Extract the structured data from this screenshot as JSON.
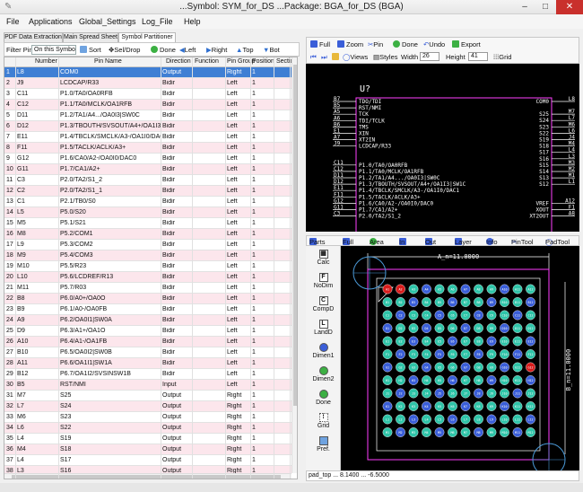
{
  "window": {
    "title": "...Symbol: SYM_for_DS ...Package: BGA_for_DS  (BGA)",
    "minimize": "–",
    "maximize": "□",
    "close": "✕"
  },
  "menu": [
    "File",
    "Applications",
    "Global_Settings",
    "Log_File",
    "Help"
  ],
  "left_tabs": [
    "PDF Data Extraction",
    "Main Spread Sheet",
    "Symbol Partitioner"
  ],
  "toolbar": {
    "filter_label": "Filter Pins",
    "filter_value": "On this Symbo",
    "sort": "Sort",
    "sel_drop": "Sel/Drop",
    "done": "Done",
    "left": "Left",
    "right": "Right",
    "top": "Top",
    "bot": "Bot"
  },
  "columns": [
    "Number",
    "Pin Name",
    "Direction",
    "Function",
    "Pin Group",
    "Position",
    "Section"
  ],
  "rows": [
    [
      "1",
      "L8",
      "COM0",
      "Output",
      "",
      "Right",
      "1"
    ],
    [
      "2",
      "J9",
      "LCDCAP/R33",
      "Bidir",
      "",
      "Left",
      "1"
    ],
    [
      "3",
      "C11",
      "P1.0/TA0/OA0RFB",
      "Bidir",
      "",
      "Left",
      "1"
    ],
    [
      "4",
      "C12",
      "P1.1/TA0/MCLK/OA1RFB",
      "Bidir",
      "",
      "Left",
      "1"
    ],
    [
      "5",
      "D11",
      "P1.2/TA1/A4.../OA0I3|SW0C",
      "Bidir",
      "",
      "Left",
      "1"
    ],
    [
      "6",
      "D12",
      "P1.3/TBOUTH/SVSOUT/A4+/OA1I3...",
      "Bidir",
      "",
      "Left",
      "1"
    ],
    [
      "7",
      "E11",
      "P1.4/TBCLK/SMCLK/A3-/OA1I0/DAC1",
      "Bidir",
      "",
      "Left",
      "1"
    ],
    [
      "8",
      "F11",
      "P1.5/TACLK/ACLK/A3+",
      "Bidir",
      "",
      "Left",
      "1"
    ],
    [
      "9",
      "G12",
      "P1.6/CA0/A2-/OA0I0/DAC0",
      "Bidir",
      "",
      "Left",
      "1"
    ],
    [
      "10",
      "G11",
      "P1.7/CA1/A2+",
      "Bidir",
      "",
      "Left",
      "1"
    ],
    [
      "11",
      "C3",
      "P2.0/TA2/S1_2",
      "Bidir",
      "",
      "Left",
      "1"
    ],
    [
      "12",
      "C2",
      "P2.0/TA2/S1_1",
      "Bidir",
      "",
      "Left",
      "1"
    ],
    [
      "13",
      "C1",
      "P2.1/TB0/S0",
      "Bidir",
      "",
      "Left",
      "1"
    ],
    [
      "14",
      "L5",
      "P5.0/S20",
      "Bidir",
      "",
      "Left",
      "1"
    ],
    [
      "15",
      "M5",
      "P5.1/S21",
      "Bidir",
      "",
      "Left",
      "1"
    ],
    [
      "16",
      "M8",
      "P5.2/COM1",
      "Bidir",
      "",
      "Left",
      "1"
    ],
    [
      "17",
      "L9",
      "P5.3/COM2",
      "Bidir",
      "",
      "Left",
      "1"
    ],
    [
      "18",
      "M9",
      "P5.4/COM3",
      "Bidir",
      "",
      "Left",
      "1"
    ],
    [
      "19",
      "M10",
      "P5.5/R23",
      "Bidir",
      "",
      "Left",
      "1"
    ],
    [
      "20",
      "L10",
      "P5.6/LCDREF/R13",
      "Bidir",
      "",
      "Left",
      "1"
    ],
    [
      "21",
      "M11",
      "P5.7/R03",
      "Bidir",
      "",
      "Left",
      "1"
    ],
    [
      "22",
      "B8",
      "P6.0/A0+/OA0O",
      "Bidir",
      "",
      "Left",
      "1"
    ],
    [
      "23",
      "B9",
      "P6.1/A0-/OA0FB",
      "Bidir",
      "",
      "Left",
      "1"
    ],
    [
      "24",
      "A9",
      "P6.2/OA0I1|SW0A",
      "Bidir",
      "",
      "Left",
      "1"
    ],
    [
      "25",
      "D9",
      "P6.3/A1+/OA1O",
      "Bidir",
      "",
      "Left",
      "1"
    ],
    [
      "26",
      "A10",
      "P6.4/A1-/OA1FB",
      "Bidir",
      "",
      "Left",
      "1"
    ],
    [
      "27",
      "B10",
      "P6.5/OA0I2|SW0B",
      "Bidir",
      "",
      "Left",
      "1"
    ],
    [
      "28",
      "A11",
      "P6.6/OA1I1|SW1A",
      "Bidir",
      "",
      "Left",
      "1"
    ],
    [
      "29",
      "B12",
      "P6.7/OA1I2/SVSINSW1B",
      "Bidir",
      "",
      "Left",
      "1"
    ],
    [
      "30",
      "B5",
      "RST/NMI",
      "Input",
      "",
      "Left",
      "1"
    ],
    [
      "31",
      "M7",
      "S25",
      "Output",
      "",
      "Right",
      "1"
    ],
    [
      "32",
      "L7",
      "S24",
      "Output",
      "",
      "Right",
      "1"
    ],
    [
      "33",
      "M6",
      "S23",
      "Output",
      "",
      "Right",
      "1"
    ],
    [
      "34",
      "L6",
      "S22",
      "Output",
      "",
      "Right",
      "1"
    ],
    [
      "35",
      "L4",
      "S19",
      "Output",
      "",
      "Right",
      "1"
    ],
    [
      "36",
      "M4",
      "S18",
      "Output",
      "",
      "Right",
      "1"
    ],
    [
      "37",
      "L4",
      "S17",
      "Output",
      "",
      "Right",
      "1"
    ],
    [
      "38",
      "L3",
      "S16",
      "Output",
      "",
      "Right",
      "1"
    ],
    [
      "39",
      "M3",
      "S15",
      "Output",
      "",
      "Right",
      "1"
    ],
    [
      "40",
      "M2",
      "S14",
      "Output",
      "",
      "Right",
      "1"
    ]
  ],
  "sym_toolbar": {
    "full": "Full",
    "zoom": "Zoom",
    "pin": "Pin",
    "done": "Done",
    "undo": "Undo",
    "export": "Export",
    "views": "Views",
    "styles": "Styles",
    "width_label": "Width",
    "width_value": "26",
    "height_label": "Height",
    "height_value": "41",
    "grid": "Grid"
  },
  "symbol": {
    "refdes": "U?",
    "left_pins": [
      {
        "num": "B7",
        "name": "TDO/TDI"
      },
      {
        "num": "B5",
        "name": "RST/NMI"
      },
      {
        "num": "A5",
        "name": "TCK"
      },
      {
        "num": "A6",
        "name": "TDI/TCLK"
      },
      {
        "num": "B6",
        "name": "TMS"
      },
      {
        "num": "E1",
        "name": "XIN"
      },
      {
        "num": "A7",
        "name": "XT2IN"
      },
      {
        "num": "J9",
        "name": "LCDCAP/R33"
      },
      {
        "num": "C11",
        "name": "P1.0/TA0/OA0RFB"
      },
      {
        "num": "C12",
        "name": "P1.1/TA0/MCLK/OA1RFB"
      },
      {
        "num": "D11",
        "name": "P1.2/TA1/A4.../OA0I3|SW0C"
      },
      {
        "num": "D12",
        "name": "P1.3/TBOUTH/SVSOUT/A4+/OA1I3|SW1C"
      },
      {
        "num": "E11",
        "name": "P1.4/TBCLK/SMCLK/A3-/OA1I0/DAC1"
      },
      {
        "num": "F11",
        "name": "P1.5/TACLK/ACLK/A3+"
      },
      {
        "num": "G12",
        "name": "P1.6/CA0/A2-/OA0I0/DAC0"
      },
      {
        "num": "G11",
        "name": "P1.7/CA1/A2+"
      },
      {
        "num": "C3",
        "name": "P2.0/TA2/S1_2"
      }
    ],
    "right_pins": [
      {
        "num": "L8",
        "name": "COM0"
      },
      {
        "num": "M7",
        "name": "S25"
      },
      {
        "num": "L7",
        "name": "S24"
      },
      {
        "num": "M6",
        "name": "S23"
      },
      {
        "num": "L6",
        "name": "S22"
      },
      {
        "num": "J4",
        "name": "S19"
      },
      {
        "num": "M4",
        "name": "S18"
      },
      {
        "num": "L4",
        "name": "S17"
      },
      {
        "num": "L3",
        "name": "S16"
      },
      {
        "num": "M3",
        "name": "S15"
      },
      {
        "num": "M2",
        "name": "S14"
      },
      {
        "num": "M1",
        "name": "S13"
      },
      {
        "num": "L1",
        "name": "S12"
      },
      {
        "num": "A12",
        "name": "VREF"
      },
      {
        "num": "F1",
        "name": "XOUT"
      },
      {
        "num": "A8",
        "name": "XT2OUT"
      }
    ]
  },
  "pkg_toolbar": {
    "parts": "Parts",
    "full": "Full",
    "area": "Area",
    "in": "In",
    "out": "Out",
    "layer": "Layer",
    "info": "Info",
    "pintool": "PinTool",
    "padtool": "PadTool"
  },
  "pkg_side": [
    "Calc",
    "NoDim",
    "CompD",
    "LandD",
    "Dimen1",
    "Dimen2",
    "Done",
    "Grid",
    "Pref."
  ],
  "package": {
    "dim_a": "A_n=11.0000",
    "dim_b": "B_n=11.0000",
    "rows": 12,
    "cols": 12
  },
  "status": "pad_top ... 8.1400 ... -6.5000",
  "colors": {
    "selected_row": "#3f7fd4",
    "pink_row": "#fce6ec",
    "symbol_body": "#ff40ff",
    "pin_text": "#ffffff",
    "pad_teal": "#2ec4a8",
    "pad_blue": "#3a5ed8",
    "pad_red": "#d81c1c",
    "outline": "#ff3cff"
  }
}
